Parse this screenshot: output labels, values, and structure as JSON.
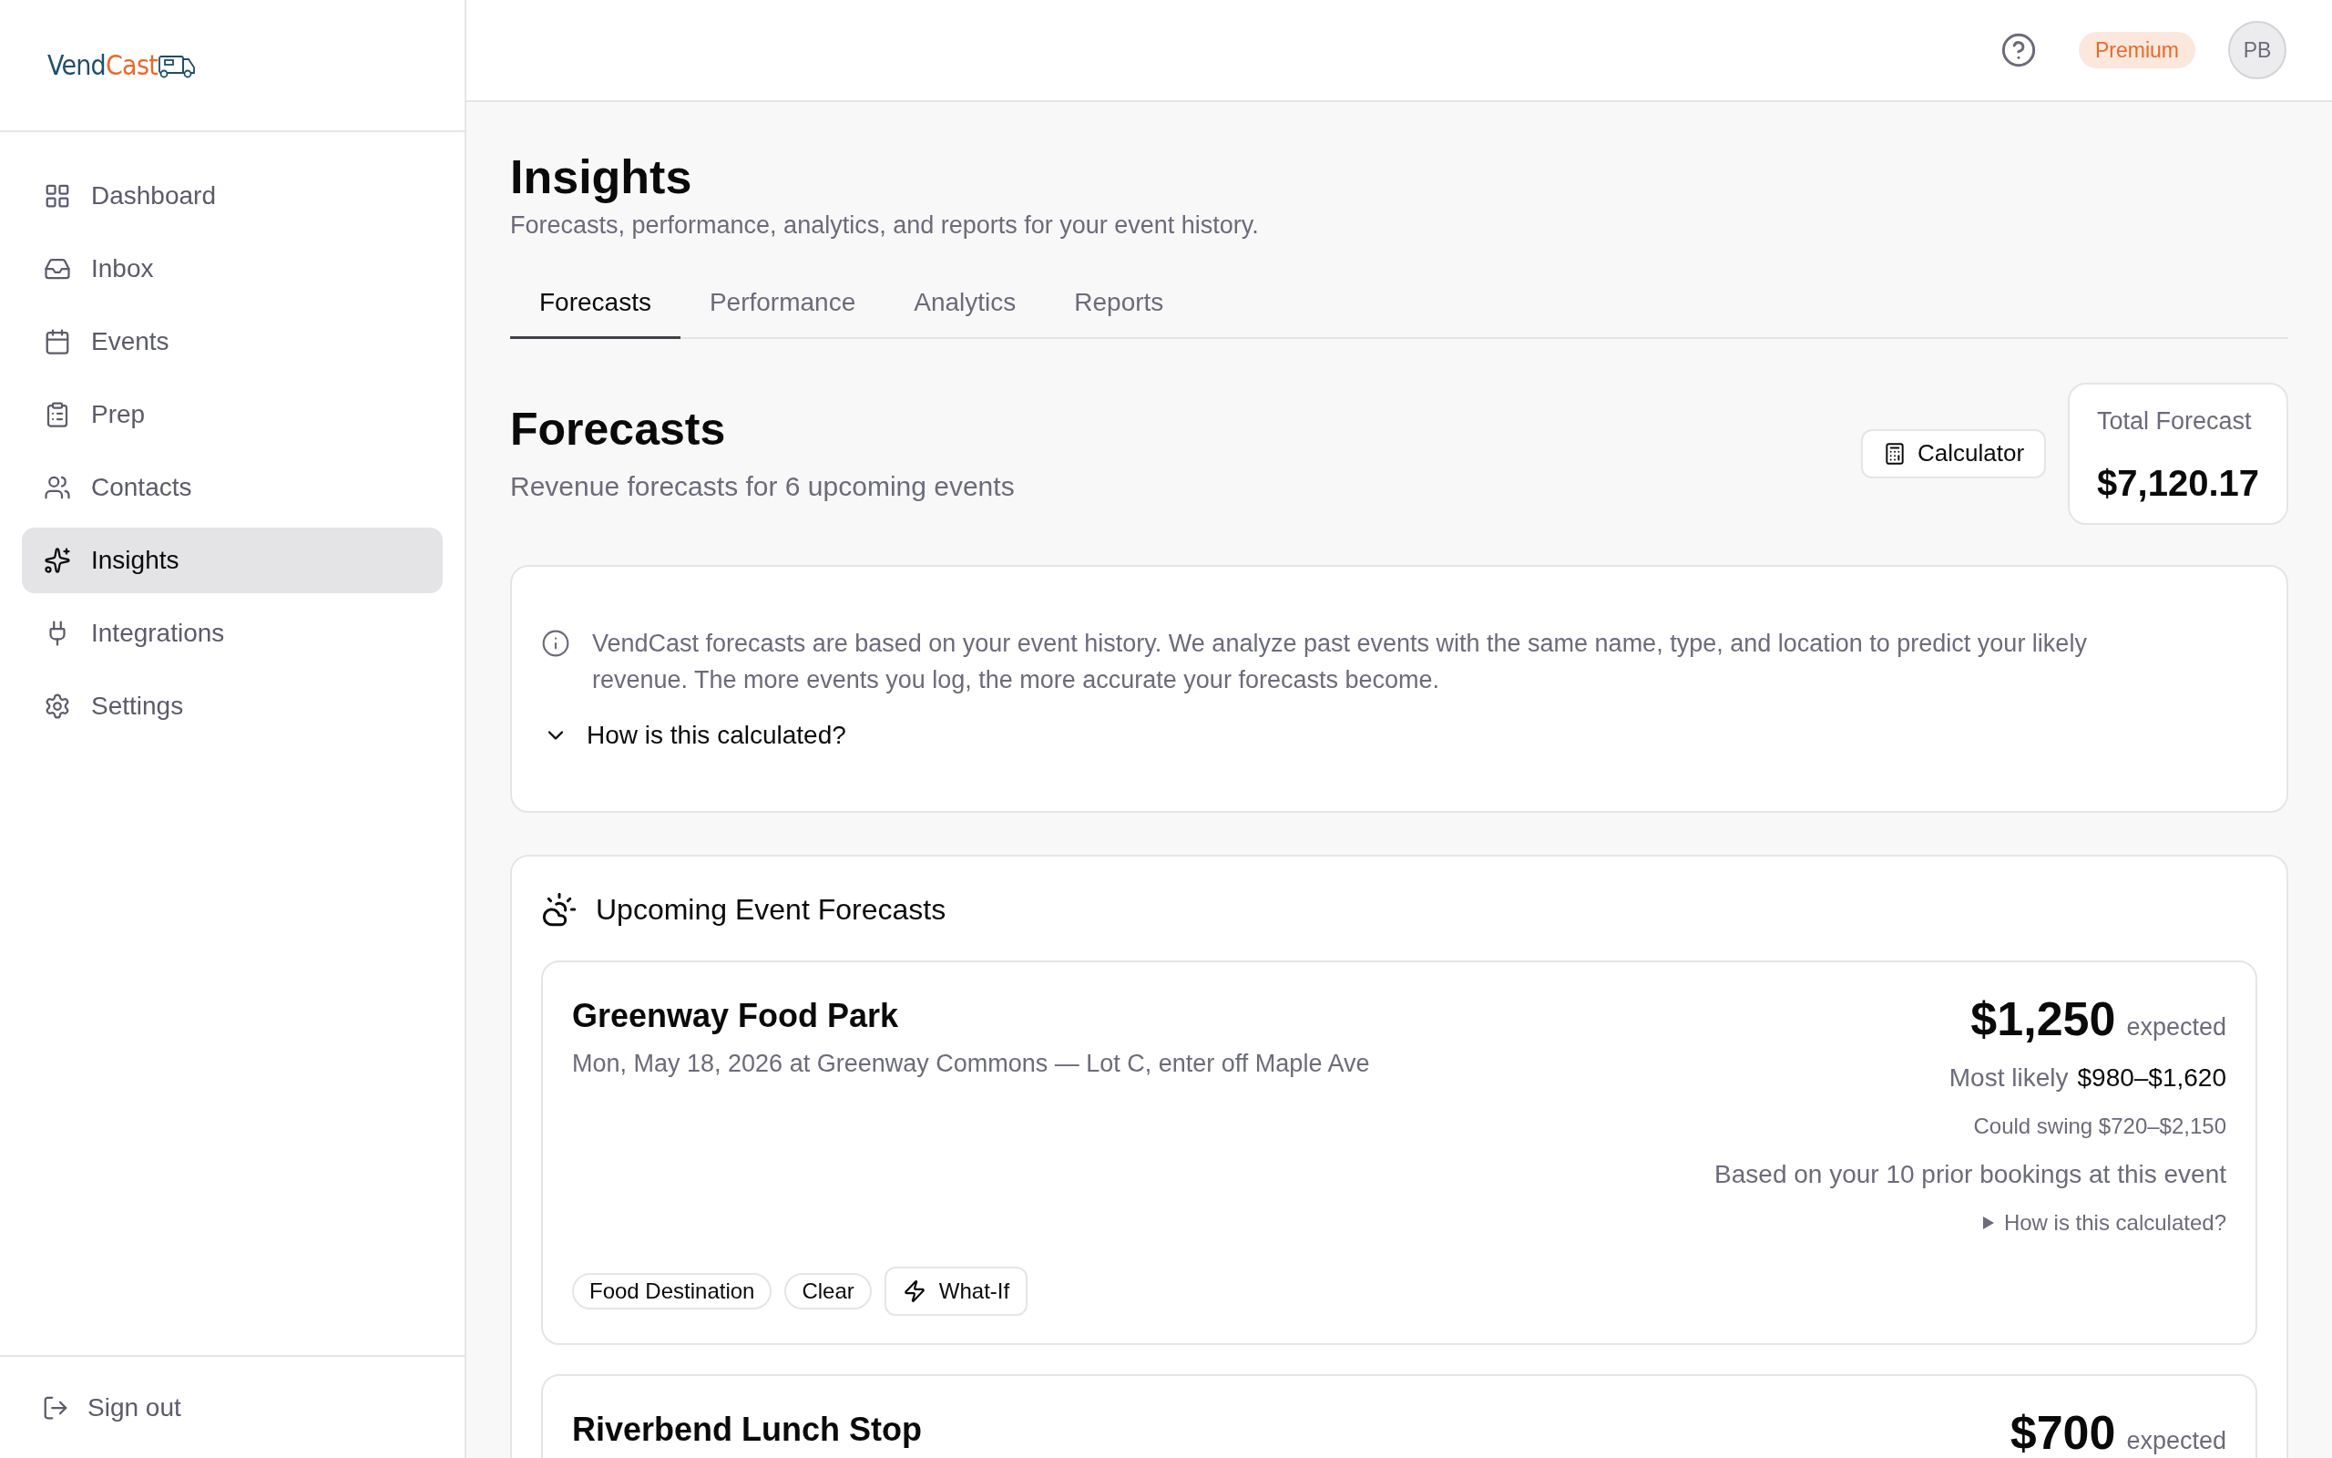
{
  "sidebar": {
    "logo": {
      "primary": "Vend",
      "accent": "Cast"
    },
    "items": [
      {
        "label": "Dashboard",
        "selected": false
      },
      {
        "label": "Inbox",
        "selected": false
      },
      {
        "label": "Events",
        "selected": false
      },
      {
        "label": "Prep",
        "selected": false
      },
      {
        "label": "Contacts",
        "selected": false
      },
      {
        "label": "Insights",
        "selected": true
      },
      {
        "label": "Integrations",
        "selected": false
      },
      {
        "label": "Settings",
        "selected": false
      }
    ],
    "sign_out": "Sign out"
  },
  "header": {
    "plan_badge": "Premium",
    "avatar": "PB"
  },
  "page": {
    "title": "Insights",
    "subtitle": "Forecasts, performance, analytics, and reports for your event history."
  },
  "tabs": [
    {
      "label": "Forecasts",
      "selected": true
    },
    {
      "label": "Performance",
      "selected": false
    },
    {
      "label": "Analytics",
      "selected": false
    },
    {
      "label": "Reports",
      "selected": false
    }
  ],
  "section": {
    "title": "Forecasts",
    "subtitle": "Revenue forecasts for 6 upcoming events",
    "calculator_button": "Calculator",
    "total": {
      "label": "Total Forecast",
      "value": "$7,120.17"
    }
  },
  "info": {
    "text": "VendCast forecasts are based on your event history. We analyze past events with the same name, type, and location to predict your likely revenue. The more events you log, the more accurate your forecasts become.",
    "toggle": "How is this calculated?"
  },
  "upcoming": {
    "title": "Upcoming Event Forecasts",
    "events": [
      {
        "name": "Greenway Food Park",
        "details": "Mon, May 18, 2026 at Greenway Commons — Lot C, enter off Maple Ave",
        "amount": "$1,250",
        "amount_suffix": "expected",
        "likely_label": "Most likely",
        "likely_range": "$980–$1,620",
        "swing": "Could swing $720–$2,150",
        "basis": "Based on your 10 prior bookings at this event",
        "calc_link": "How is this calculated?",
        "tags": [
          "Food Destination",
          "Clear"
        ],
        "what_if": "What-If"
      },
      {
        "name": "Riverbend Lunch Stop",
        "amount": "$700",
        "amount_suffix": "expected"
      }
    ]
  }
}
